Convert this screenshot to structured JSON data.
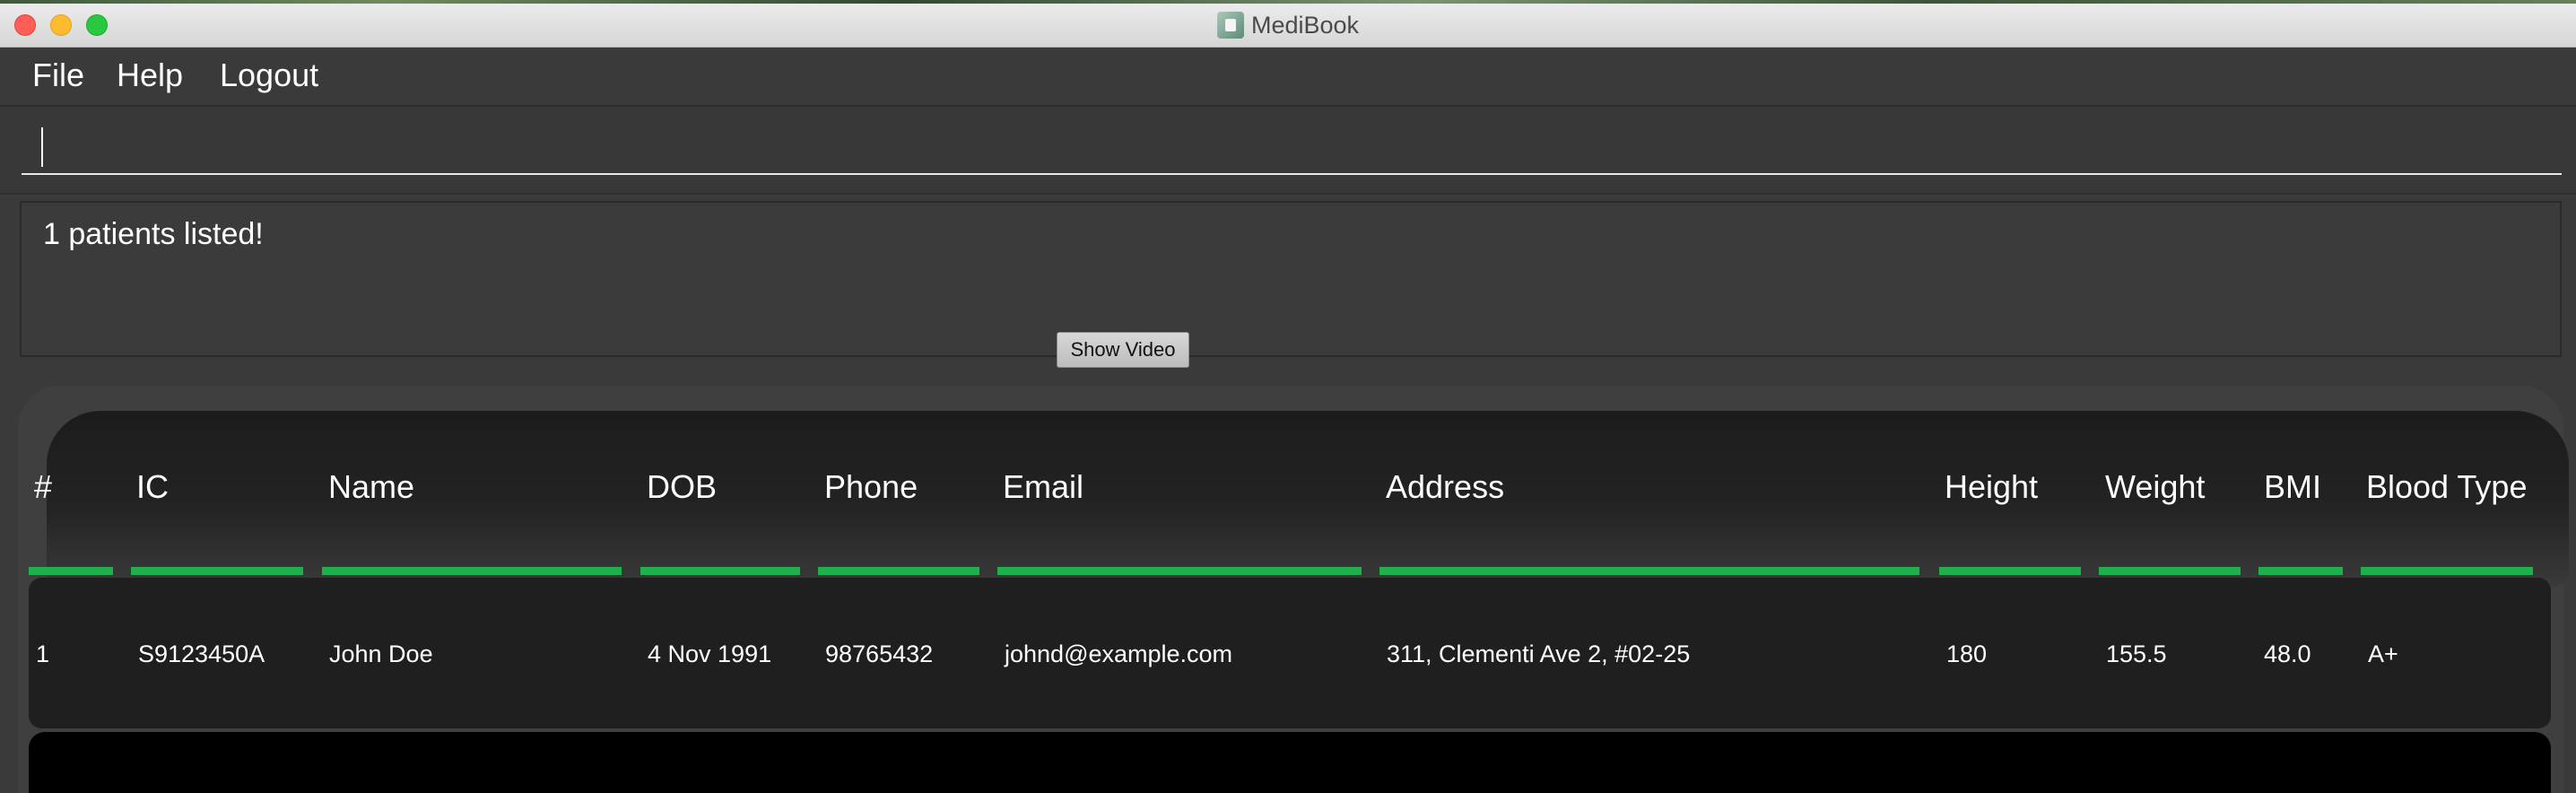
{
  "window": {
    "title": "MediBook",
    "icon": "medibook-app-icon"
  },
  "menu": {
    "items": [
      "File",
      "Help",
      "Logout"
    ]
  },
  "command": {
    "value": "",
    "placeholder": ""
  },
  "result": {
    "message": "1 patients listed!"
  },
  "show_video_button": "Show Video",
  "table": {
    "columns": [
      "#",
      "IC",
      "Name",
      "DOB",
      "Phone",
      "Email",
      "Address",
      "Height",
      "Weight",
      "BMI",
      "Blood Type"
    ],
    "rows": [
      [
        "1",
        "S9123450A",
        "John Doe",
        "4 Nov 1991",
        "98765432",
        "johnd@example.com",
        "311, Clementi Ave 2, #02-25",
        "180",
        "155.5",
        "48.0",
        "A+"
      ]
    ]
  },
  "colors": {
    "accent_green": "#1fb04c",
    "background": "#3a3a3a",
    "row_background": "#1f1f1f"
  }
}
